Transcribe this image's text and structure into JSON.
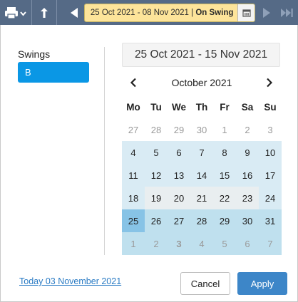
{
  "toolbar": {
    "range_dates": "25 Oct 2021 - 08 Nov 2021",
    "range_separator": " | ",
    "range_tag": "On Swing",
    "icons": [
      "printer-icon",
      "chevron-down-icon",
      "upload-icon",
      "triangle-left-icon",
      "calendar-icon",
      "triangle-right-icon",
      "skip-forward-icon"
    ]
  },
  "sidebar": {
    "title": "Swings",
    "items": [
      {
        "label": "B",
        "selected": true
      }
    ]
  },
  "picker": {
    "range_display": "25 Oct 2021 - 15 Nov 2021",
    "month_label": "October 2021",
    "weekdays": [
      "Mo",
      "Tu",
      "We",
      "Th",
      "Fr",
      "Sa",
      "Su"
    ],
    "weeks": [
      [
        {
          "d": "27",
          "s": "muted"
        },
        {
          "d": "28",
          "s": "muted"
        },
        {
          "d": "29",
          "s": "muted"
        },
        {
          "d": "30",
          "s": "muted"
        },
        {
          "d": "1",
          "s": "muted"
        },
        {
          "d": "2",
          "s": "muted"
        },
        {
          "d": "3",
          "s": "muted"
        }
      ],
      [
        {
          "d": "4",
          "s": "inrange"
        },
        {
          "d": "5",
          "s": "inrange"
        },
        {
          "d": "6",
          "s": "inrange"
        },
        {
          "d": "7",
          "s": "inrange"
        },
        {
          "d": "8",
          "s": "inrange"
        },
        {
          "d": "9",
          "s": "inrange"
        },
        {
          "d": "10",
          "s": "inrange"
        }
      ],
      [
        {
          "d": "11",
          "s": "inrange"
        },
        {
          "d": "12",
          "s": "inrange"
        },
        {
          "d": "13",
          "s": "inrange"
        },
        {
          "d": "14",
          "s": "inrange"
        },
        {
          "d": "15",
          "s": "inrange"
        },
        {
          "d": "16",
          "s": "inrange"
        },
        {
          "d": "17",
          "s": "inrange"
        }
      ],
      [
        {
          "d": "18",
          "s": "inrange"
        },
        {
          "d": "19",
          "s": "hover"
        },
        {
          "d": "20",
          "s": "hover"
        },
        {
          "d": "21",
          "s": "hover"
        },
        {
          "d": "22",
          "s": "hover"
        },
        {
          "d": "23",
          "s": "hover"
        },
        {
          "d": "24",
          "s": "inrange"
        }
      ],
      [
        {
          "d": "25",
          "s": "selected"
        },
        {
          "d": "26",
          "s": "inrange-dark"
        },
        {
          "d": "27",
          "s": "inrange-dark"
        },
        {
          "d": "28",
          "s": "inrange-dark"
        },
        {
          "d": "29",
          "s": "inrange-dark"
        },
        {
          "d": "30",
          "s": "inrange-dark"
        },
        {
          "d": "31",
          "s": "inrange-dark"
        }
      ],
      [
        {
          "d": "1",
          "s": "muted inrange-dark"
        },
        {
          "d": "2",
          "s": "muted inrange-dark"
        },
        {
          "d": "3",
          "s": "muted inrange-dark today"
        },
        {
          "d": "4",
          "s": "muted inrange-dark"
        },
        {
          "d": "5",
          "s": "muted inrange-dark"
        },
        {
          "d": "6",
          "s": "muted inrange-dark"
        },
        {
          "d": "7",
          "s": "muted inrange-dark"
        }
      ]
    ]
  },
  "footer": {
    "today_link": "Today 03 November 2021",
    "cancel_label": "Cancel",
    "apply_label": "Apply"
  },
  "colors": {
    "toolbar_bg": "#556a86",
    "range_highlight": "#fde49a",
    "swing_selected": "#0a97e5",
    "apply_button": "#3d86c8",
    "selected_day": "#87c3e6"
  }
}
